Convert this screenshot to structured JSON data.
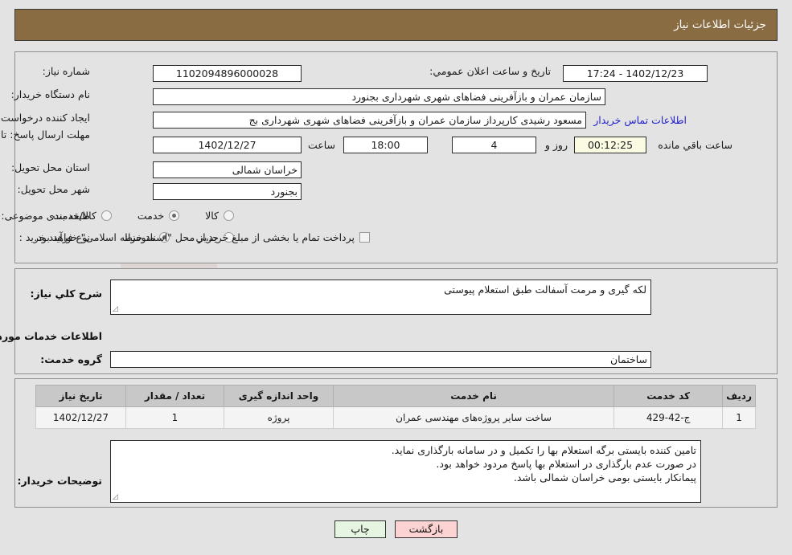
{
  "header": {
    "title": "جزئیات اطلاعات نیاز"
  },
  "form": {
    "need_number_label": "شماره نیاز:",
    "need_number_value": "1102094896000028",
    "buyer_org_label": "نام دستگاه خریدار:",
    "buyer_org_value": "سازمان عمران و بازآفرینی فضاهای شهری شهرداری بجنورد",
    "requester_label": "ایجاد کننده درخواست:",
    "requester_value": "مسعود رشیدی کارپرداز سازمان عمران و بازآفرینی فضاهای شهری شهرداری بج",
    "buyer_contact_link": "اطلاعات تماس خریدار",
    "deadline_label": "مهلت ارسال پاسخ: تا تاریخ:",
    "deadline_date": "1402/12/27",
    "deadline_hour_label": "ساعت",
    "deadline_hour_value": "18:00",
    "remaining_days_value": "4",
    "remaining_days_label": "روز و",
    "remaining_time_value": "00:12:25",
    "remaining_time_label": "ساعت باقي مانده",
    "announce_label": "تاریخ و ساعت اعلان عمومي:",
    "announce_value": "1402/12/23 - 17:24",
    "province_label": "استان محل تحویل:",
    "province_value": "خراسان شمالی",
    "city_label": "شهر محل تحویل:",
    "city_value": "بجنورد",
    "category_label": "طبقه بندی موضوعی:",
    "category_options": [
      {
        "label": "کالا",
        "selected": false
      },
      {
        "label": "خدمت",
        "selected": true
      },
      {
        "label": "کالا/خدمت",
        "selected": false
      }
    ],
    "process_label": "نوع فرآیند خرید :",
    "process_options": [
      {
        "label": "جزیي",
        "selected": false
      },
      {
        "label": "متوسط",
        "selected": true
      }
    ],
    "treasury_checkbox_label": "پرداخت تمام یا بخشی از مبلغ خرید،از محل \"اسناد خزانه اسلامی\" خواهد بود.",
    "treasury_checked": false
  },
  "summary": {
    "need_desc_label": "شرح کلي نیاز:",
    "need_desc_value": "لکه گیری و مرمت آسفالت طبق استعلام پیوستی",
    "services_section_title": "اطلاعات خدمات مورد نیاز",
    "service_group_label": "گروه خدمت:",
    "service_group_value": "ساختمان"
  },
  "table": {
    "columns": [
      "ردیف",
      "کد خدمت",
      "نام خدمت",
      "واحد اندازه گیری",
      "تعداد / مقدار",
      "تاریخ نیاز"
    ],
    "rows": [
      {
        "row_no": "1",
        "service_code": "ج-42-429",
        "service_name": "ساخت سایر پروژه‌های مهندسی عمران",
        "unit": "پروژه",
        "quantity": "1",
        "need_date": "1402/12/27"
      }
    ]
  },
  "buyer_notes": {
    "label": "توضیحات خریدار:",
    "value": "تامین کننده بایستی برگه استعلام بها را تکمیل و در سامانه بارگذاری نماید.\nدر صورت عدم بارگذاری در استعلام بها پاسخ مردود خواهد بود.\nپیمانکار بایستی بومی خراسان شمالی باشد."
  },
  "buttons": {
    "print": "چاپ",
    "back": "بازگشت"
  },
  "watermark": {
    "text": "AriaTender.net"
  },
  "colors": {
    "header_bg": "#8a6c43",
    "page_bg": "#e3e3e3",
    "link": "#2222cc",
    "print_btn": "#e6f5e2",
    "back_btn": "#fbd3d3",
    "table_header": "#c8c8c8"
  }
}
